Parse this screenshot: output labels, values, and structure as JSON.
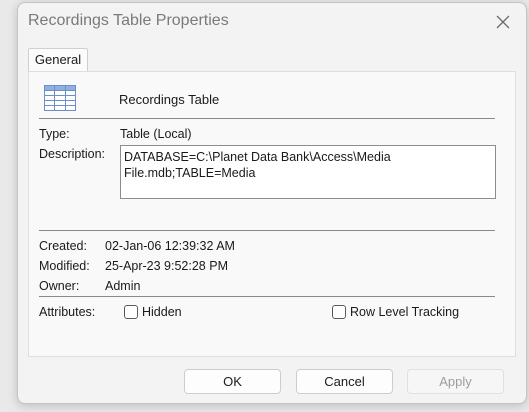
{
  "window": {
    "title": "Recordings Table Properties",
    "close_icon": "close-icon"
  },
  "tabs": [
    {
      "label": "General",
      "selected": true
    }
  ],
  "general": {
    "icon": "table-icon",
    "object_name": "Recordings Table",
    "type_label": "Type:",
    "type_value": "Table (Local)",
    "description_label": "Description:",
    "description_value": "DATABASE=C:\\Planet Data Bank\\Access\\Media File.mdb;TABLE=Media",
    "created_label": "Created:",
    "created_value": "02-Jan-06 12:39:32 AM",
    "modified_label": "Modified:",
    "modified_value": "25-Apr-23 9:52:28 PM",
    "owner_label": "Owner:",
    "owner_value": "Admin",
    "attributes_label": "Attributes:",
    "hidden_label": "Hidden",
    "hidden_checked": false,
    "row_level_tracking_label": "Row Level Tracking",
    "row_level_tracking_checked": false
  },
  "buttons": {
    "ok": "OK",
    "cancel": "Cancel",
    "apply": "Apply"
  }
}
